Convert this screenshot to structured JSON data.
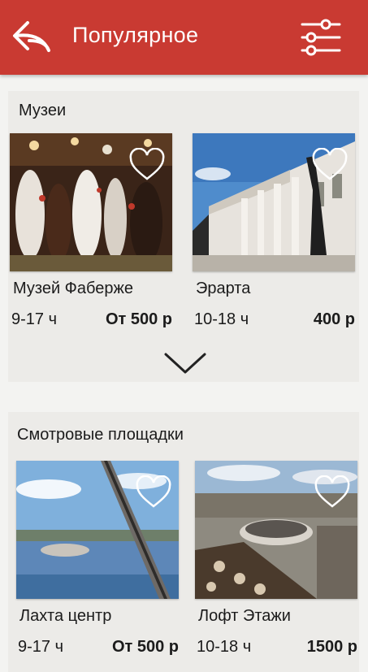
{
  "header": {
    "title": "Популярное",
    "back_icon": "back-arrow-icon",
    "filter_icon": "sliders-icon",
    "bar_color": "#c93a32"
  },
  "sections": [
    {
      "title": "Музеи",
      "cards": [
        {
          "name": "Музей Фаберже",
          "hours": "9-17 ч",
          "price": "От 500 р",
          "favorite_icon": "heart-icon"
        },
        {
          "name": "Эрарта",
          "hours": "10-18 ч",
          "price": "400 р",
          "favorite_icon": "heart-icon"
        }
      ],
      "expand_icon": "chevron-down-icon"
    },
    {
      "title": "Смотровые площадки",
      "cards": [
        {
          "name": "Лахта центр",
          "hours": "9-17 ч",
          "price": "От 500 р",
          "favorite_icon": "heart-icon"
        },
        {
          "name": "Лофт Этажи",
          "hours": "10-18 ч",
          "price": "1500 р",
          "favorite_icon": "heart-icon"
        }
      ]
    }
  ]
}
